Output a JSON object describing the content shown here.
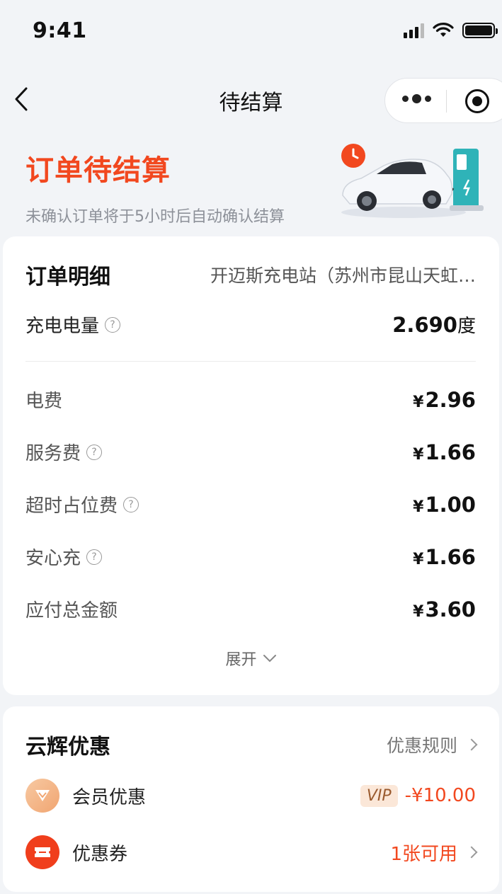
{
  "status_bar": {
    "time": "9:41"
  },
  "nav": {
    "title": "待结算"
  },
  "hero": {
    "title": "订单待结算",
    "subtitle": "未确认订单将于5小时后自动确认结算"
  },
  "order_detail": {
    "heading": "订单明细",
    "station": "开迈斯充电站（苏州市昆山天虹…",
    "charge_label": "充电电量",
    "charge_value": "2.690",
    "charge_unit": "度",
    "currency": "¥",
    "fees": [
      {
        "label": "电费",
        "value": "2.96"
      },
      {
        "label": "服务费",
        "value": "1.66"
      },
      {
        "label": "超时占位费",
        "value": "1.00"
      },
      {
        "label": "安心充",
        "value": "1.66"
      },
      {
        "label": "应付总金额",
        "value": "3.60"
      }
    ],
    "expand_label": "展开"
  },
  "discounts": {
    "heading": "云辉优惠",
    "rules_link": "优惠规则",
    "member_label": "会员优惠",
    "vip_badge": "VIP",
    "member_discount": "-¥10.00",
    "coupon_label": "优惠券",
    "coupon_available": "1张可用"
  },
  "colors": {
    "accent": "#f2481f",
    "background": "#f2f4f7"
  }
}
